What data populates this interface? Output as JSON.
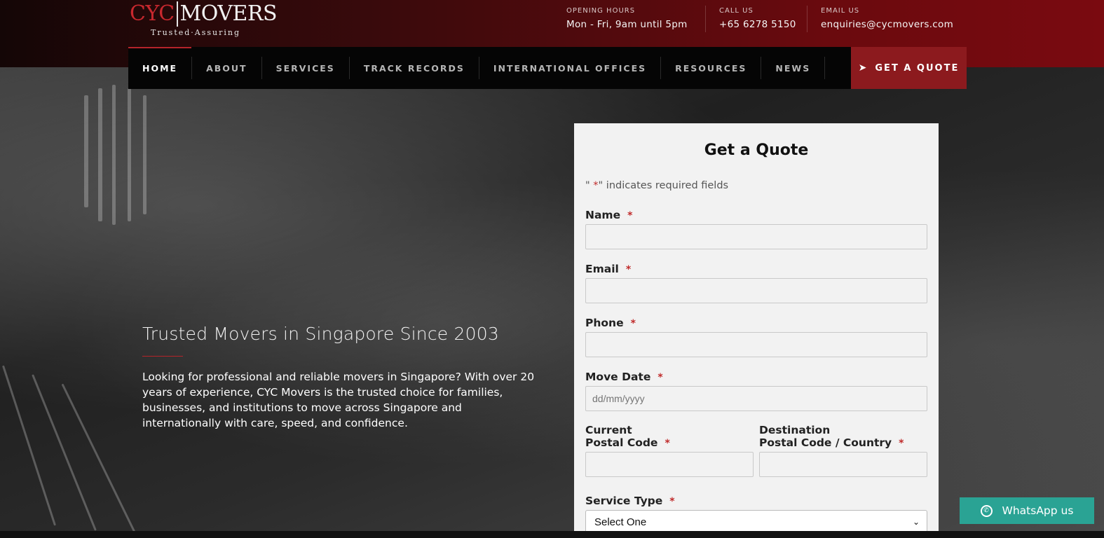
{
  "header": {
    "logo": {
      "cyc": "CYC",
      "movers": "MOVERS",
      "tagline": "Trusted·Assuring"
    },
    "contacts": [
      {
        "label": "OPENING HOURS",
        "value": "Mon - Fri, 9am until 5pm"
      },
      {
        "label": "CALL US",
        "value": "+65 6278 5150"
      },
      {
        "label": "EMAIL US",
        "value": "enquiries@cycmovers.com"
      }
    ]
  },
  "nav": {
    "items": [
      "HOME",
      "ABOUT",
      "SERVICES",
      "TRACK RECORDS",
      "INTERNATIONAL OFFICES",
      "RESOURCES",
      "NEWS"
    ],
    "active": "HOME",
    "quote_label": "GET A QUOTE"
  },
  "hero": {
    "title": "Trusted Movers in Singapore Since 2003",
    "text": "Looking for professional and reliable movers in Singapore? With over 20 years of experience, CYC Movers is the trusted choice for families, businesses, and institutions to move across Singapore and internationally with care, speed, and confidence."
  },
  "form": {
    "title": "Get a Quote",
    "required_note_prefix": "\" ",
    "required_note_star": "*",
    "required_note_suffix": "\" indicates required fields",
    "star": "*",
    "name_label": "Name",
    "email_label": "Email",
    "phone_label": "Phone",
    "move_date_label": "Move Date",
    "move_date_placeholder": "dd/mm/yyyy",
    "current_label_line1": "Current",
    "current_label_line2": "Postal Code",
    "destination_label_line1": "Destination",
    "destination_label_line2": "Postal Code / Country",
    "service_type_label": "Service Type",
    "service_type_value": "Select One"
  },
  "whatsapp": {
    "label": "WhatsApp us"
  },
  "colors": {
    "accent": "#8c1a1e",
    "star": "#c02b2b",
    "whatsapp": "#2aa394"
  }
}
